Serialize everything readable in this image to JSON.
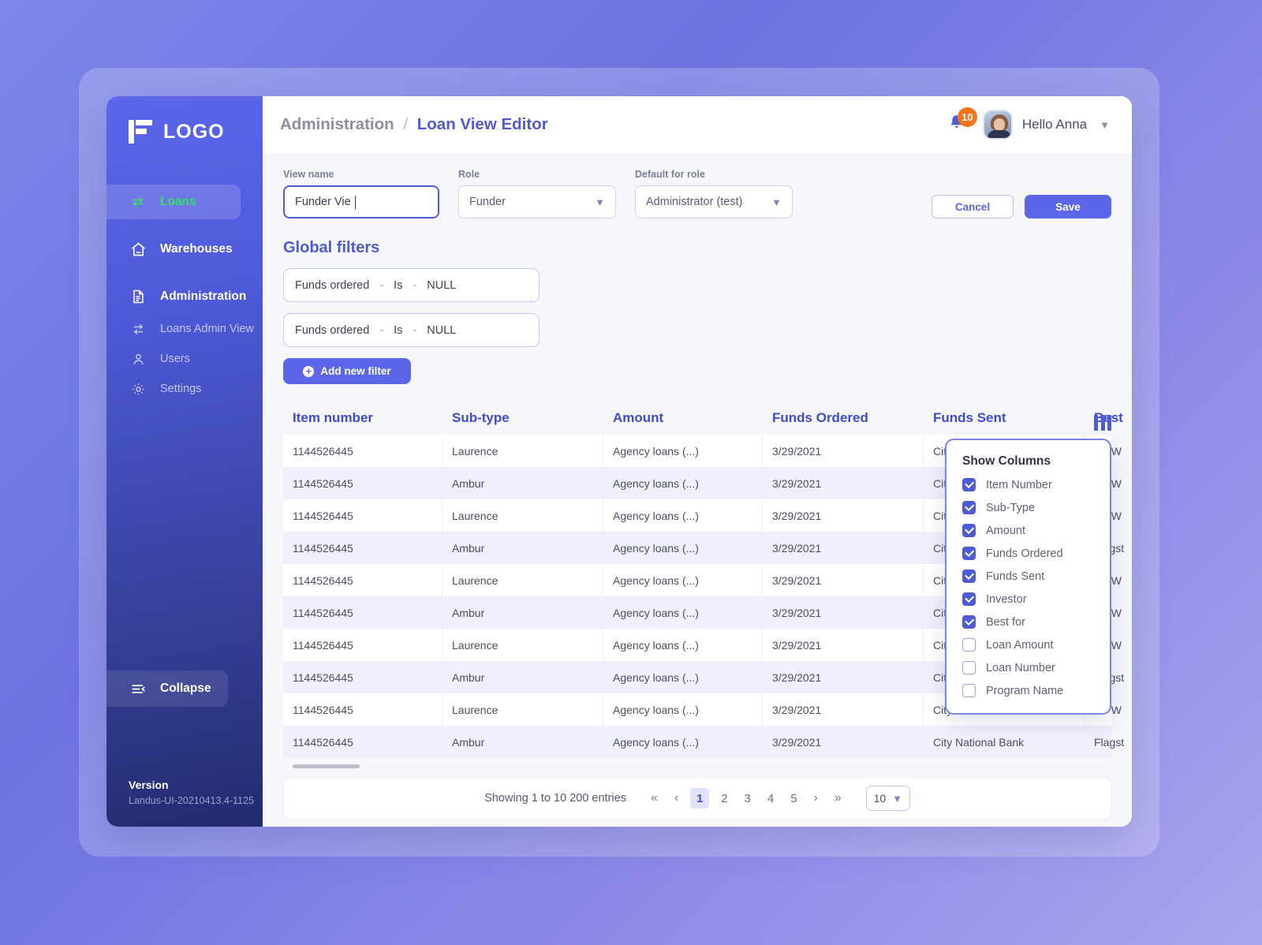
{
  "sidebar": {
    "logo_text": "LOGO",
    "items": [
      {
        "label": "Loans",
        "icon": "transfer-icon",
        "active": true
      },
      {
        "label": "Warehouses",
        "icon": "home-icon",
        "active": false
      },
      {
        "label": "Administration",
        "icon": "document-icon",
        "active": false,
        "expanded": true
      }
    ],
    "sub_items": [
      {
        "label": "Loans Admin View",
        "icon": "transfer-icon"
      },
      {
        "label": "Users",
        "icon": "user-icon"
      },
      {
        "label": "Settings",
        "icon": "gear-icon"
      }
    ],
    "collapse_label": "Collapse",
    "collapse_icon": "collapse-icon",
    "version_title": "Version",
    "version_value": "Landus-UI-20210413.4-1125"
  },
  "header": {
    "breadcrumb_parent": "Administration",
    "breadcrumb_separator": "/",
    "breadcrumb_current": "Loan View Editor",
    "notification_count": "10",
    "notification_icon": "bell-icon",
    "greeting": "Hello Anna",
    "chevron_icon": "chevron-down-icon"
  },
  "form": {
    "view_name_label": "View name",
    "view_name_value": "Funder Vie",
    "role_label": "Role",
    "role_value": "Funder",
    "default_role_label": "Default for role",
    "default_role_value": "Administrator (test)",
    "cancel_label": "Cancel",
    "save_label": "Save"
  },
  "filters": {
    "title": "Global filters",
    "rows": [
      {
        "field": "Funds ordered",
        "dash1": "-",
        "operator": "Is",
        "dash2": "-",
        "value": "NULL"
      },
      {
        "field": "Funds ordered",
        "dash1": "-",
        "operator": "Is",
        "dash2": "-",
        "value": "NULL"
      }
    ],
    "add_label": "Add new filter",
    "add_icon": "plus-circle-icon"
  },
  "table": {
    "columns_icon": "column-settings-icon",
    "headers": [
      "Item number",
      "Sub-type",
      "Amount",
      "Funds Ordered",
      "Funds Sent",
      "Best"
    ],
    "rows": [
      [
        "1144526445",
        "Laurence",
        "Agency loans (...)",
        "3/29/2021",
        "City National Bank",
        "No W"
      ],
      [
        "1144526445",
        "Ambur",
        "Agency loans (...)",
        "3/29/2021",
        "City National Bank",
        "No W"
      ],
      [
        "1144526445",
        "Laurence",
        "Agency loans (...)",
        "3/29/2021",
        "City National Bank",
        "No W"
      ],
      [
        "1144526445",
        "Ambur",
        "Agency loans (...)",
        "3/29/2021",
        "City National Bank",
        "Flagst"
      ],
      [
        "1144526445",
        "Laurence",
        "Agency loans (...)",
        "3/29/2021",
        "City National Bank",
        "No W"
      ],
      [
        "1144526445",
        "Ambur",
        "Agency loans (...)",
        "3/29/2021",
        "City National Bank",
        "No W"
      ],
      [
        "1144526445",
        "Laurence",
        "Agency loans (...)",
        "3/29/2021",
        "City National Bank",
        "No W"
      ],
      [
        "1144526445",
        "Ambur",
        "Agency loans (...)",
        "3/29/2021",
        "City National Bank",
        "Flagst"
      ],
      [
        "1144526445",
        "Laurence",
        "Agency loans (...)",
        "3/29/2021",
        "City National Bank",
        "No W"
      ],
      [
        "1144526445",
        "Ambur",
        "Agency loans (...)",
        "3/29/2021",
        "City National Bank",
        "Flagst"
      ]
    ]
  },
  "pagination": {
    "showing_text": "Showing 1 to 10 200 entries",
    "first_icon": "«",
    "prev_icon": "‹",
    "pages": [
      "1",
      "2",
      "3",
      "4",
      "5"
    ],
    "current_page": "1",
    "next_icon": "›",
    "last_icon": "»",
    "page_size": "10",
    "page_size_chevron": "chevron-down-icon"
  },
  "show_columns": {
    "title": "Show Columns",
    "items": [
      {
        "label": "Item Number",
        "checked": true
      },
      {
        "label": "Sub-Type",
        "checked": true
      },
      {
        "label": "Amount",
        "checked": true
      },
      {
        "label": "Funds Ordered",
        "checked": true
      },
      {
        "label": "Funds Sent",
        "checked": true
      },
      {
        "label": "Investor",
        "checked": true
      },
      {
        "label": "Best for",
        "checked": true
      },
      {
        "label": "Loan Amount",
        "checked": false
      },
      {
        "label": "Loan Number",
        "checked": false
      },
      {
        "label": "Program Name",
        "checked": false
      }
    ]
  },
  "colors": {
    "brand": "#4f5bd5",
    "accent_green": "#36e06a",
    "badge_orange": "#f97317",
    "sidebar_top": "#5b66e8",
    "sidebar_bottom": "#222b6e"
  }
}
